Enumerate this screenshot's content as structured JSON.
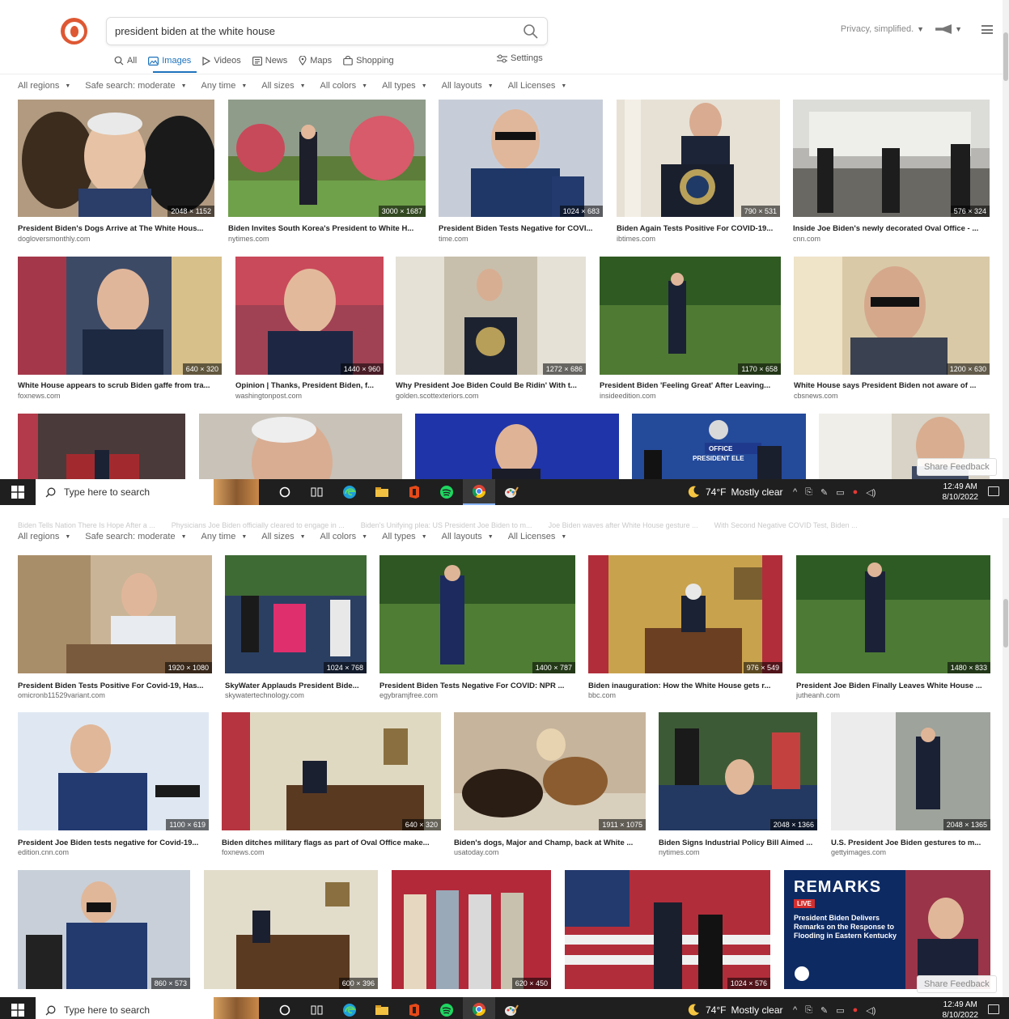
{
  "search": {
    "query": "president biden at the white house"
  },
  "header": {
    "privacy": "Privacy, simplified.",
    "tabs": [
      {
        "label": "All",
        "icon": "search-icon"
      },
      {
        "label": "Images",
        "icon": "image-icon"
      },
      {
        "label": "Videos",
        "icon": "play-icon"
      },
      {
        "label": "News",
        "icon": "newspaper-icon"
      },
      {
        "label": "Maps",
        "icon": "map-pin-icon"
      },
      {
        "label": "Shopping",
        "icon": "shopping-bag-icon"
      }
    ],
    "settings": "Settings"
  },
  "filters": [
    "All regions",
    "Safe search: moderate",
    "Any time",
    "All sizes",
    "All colors",
    "All types",
    "All layouts",
    "All Licenses"
  ],
  "share_feedback": "Share Feedback",
  "panel1": {
    "row1": [
      {
        "title": "President Biden's Dogs Arrive at The White Hous...",
        "source": "dogloversmonthly.com",
        "dims": "2048 × 1152"
      },
      {
        "title": "Biden Invites South Korea's President to White H...",
        "source": "nytimes.com",
        "dims": "3000 × 1687"
      },
      {
        "title": "President Biden Tests Negative for COVI...",
        "source": "time.com",
        "dims": "1024 × 683"
      },
      {
        "title": "Biden Again Tests Positive For COVID-19...",
        "source": "ibtimes.com",
        "dims": "790 × 531"
      },
      {
        "title": "Inside Joe Biden's newly decorated Oval Office - ...",
        "source": "cnn.com",
        "dims": "576 × 324"
      }
    ],
    "row2": [
      {
        "title": "White House appears to scrub Biden gaffe from tra...",
        "source": "foxnews.com",
        "dims": "640 × 320"
      },
      {
        "title": "Opinion | Thanks, President Biden, f...",
        "source": "washingtonpost.com",
        "dims": "1440 × 960"
      },
      {
        "title": "Why President Joe Biden Could Be Ridin' With t...",
        "source": "golden.scottexteriors.com",
        "dims": "1272 × 686"
      },
      {
        "title": "President Biden 'Feeling Great' After Leaving...",
        "source": "insideedition.com",
        "dims": "1170 × 658"
      },
      {
        "title": "White House says President Biden not aware of ...",
        "source": "cbsnews.com",
        "dims": "1200 × 630"
      }
    ]
  },
  "panel2": {
    "row1": [
      {
        "title": "President Biden Tests Positive For Covid-19, Has...",
        "source": "omicronb11529variant.com",
        "dims": "1920 × 1080"
      },
      {
        "title": "SkyWater Applauds President Bide...",
        "source": "skywatertechnology.com",
        "dims": "1024 × 768"
      },
      {
        "title": "President Biden Tests Negative For COVID: NPR ...",
        "source": "egybramjfree.com",
        "dims": "1400 × 787"
      },
      {
        "title": "Biden inauguration: How the White House gets r...",
        "source": "bbc.com",
        "dims": "976 × 549"
      },
      {
        "title": "President Joe Biden Finally Leaves White House ...",
        "source": "jutheanh.com",
        "dims": "1480 × 833"
      }
    ],
    "row2": [
      {
        "title": "President Joe Biden tests negative for Covid-19...",
        "source": "edition.cnn.com",
        "dims": "1100 × 619"
      },
      {
        "title": "Biden ditches military flags as part of Oval Office make...",
        "source": "foxnews.com",
        "dims": "640 × 320"
      },
      {
        "title": "Biden's dogs, Major and Champ, back at White ...",
        "source": "usatoday.com",
        "dims": "1911 × 1075"
      },
      {
        "title": "Biden Signs Industrial Policy Bill Aimed ...",
        "source": "nytimes.com",
        "dims": "2048 × 1366"
      },
      {
        "title": "U.S. President Joe Biden gestures to m...",
        "source": "gettyimages.com",
        "dims": "2048 × 1365"
      }
    ],
    "row3": [
      {
        "dims": "860 × 573"
      },
      {
        "dims": "600 × 396"
      },
      {
        "dims": "620 × 450"
      },
      {
        "dims": "1024 × 576"
      },
      {
        "remarks": "REMARKS",
        "live": "LIVE",
        "headline": "President Biden Delivers Remarks on the Response to Flooding in Eastern Kentucky"
      }
    ]
  },
  "taskbar": {
    "search_placeholder": "Type here to search",
    "temp": "74°F",
    "weather": "Mostly clear",
    "time": "12:49 AM",
    "date": "8/10/2022"
  }
}
